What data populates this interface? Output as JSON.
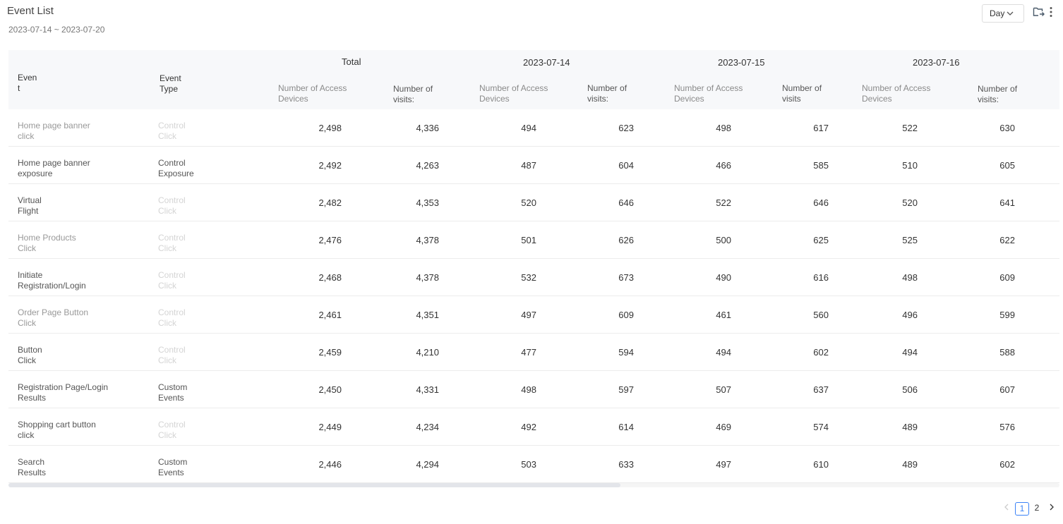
{
  "header": {
    "title": "Event List",
    "date_range": "2023-07-14 ~ 2023-07-20",
    "granularity": "Day"
  },
  "table": {
    "col_event": "Even\nt",
    "col_type": "Event\nType",
    "groups": [
      "Total",
      "2023-07-14",
      "2023-07-15",
      "2023-07-16"
    ],
    "sub_headers": [
      "Number of Access\nDevices",
      "Number of\nvisits:",
      "Number of Access\nDevices",
      "Number of\nvisits:",
      "Number of Access\nDevices",
      "Number of\nvisits",
      "Number of Access\nDevices",
      "Number of\nvisits:"
    ],
    "rows": [
      {
        "event": "Home page banner\nclick",
        "type": "Control\nClick",
        "values": [
          "2,498",
          "4,336",
          "494",
          "623",
          "498",
          "617",
          "522",
          "630"
        ]
      },
      {
        "event": "Home page banner\nexposure",
        "type": "Control\nExposure",
        "values": [
          "2,492",
          "4,263",
          "487",
          "604",
          "466",
          "585",
          "510",
          "605"
        ]
      },
      {
        "event": "Virtual\nFlight",
        "type": "Control\nClick",
        "values": [
          "2,482",
          "4,353",
          "520",
          "646",
          "522",
          "646",
          "520",
          "641"
        ]
      },
      {
        "event": "Home Products\nClick",
        "type": "Control\nClick",
        "values": [
          "2,476",
          "4,378",
          "501",
          "626",
          "500",
          "625",
          "525",
          "622"
        ]
      },
      {
        "event": "Initiate\nRegistration/Login",
        "type": "Control\nClick",
        "values": [
          "2,468",
          "4,378",
          "532",
          "673",
          "490",
          "616",
          "498",
          "609"
        ]
      },
      {
        "event": "Order Page Button\nClick",
        "type": "Control\nClick",
        "values": [
          "2,461",
          "4,351",
          "497",
          "609",
          "461",
          "560",
          "496",
          "599"
        ]
      },
      {
        "event": "Button\nClick",
        "type": "Control\nClick",
        "values": [
          "2,459",
          "4,210",
          "477",
          "594",
          "494",
          "602",
          "494",
          "588"
        ]
      },
      {
        "event": "Registration Page/Login\nResults",
        "type": "Custom\nEvents",
        "values": [
          "2,450",
          "4,331",
          "498",
          "597",
          "507",
          "637",
          "506",
          "607"
        ]
      },
      {
        "event": "Shopping cart button\nclick",
        "type": "Control\nClick",
        "values": [
          "2,449",
          "4,234",
          "492",
          "614",
          "469",
          "574",
          "489",
          "576"
        ]
      },
      {
        "event": "Search\nResults",
        "type": "Custom\nEvents",
        "values": [
          "2,446",
          "4,294",
          "503",
          "633",
          "497",
          "610",
          "489",
          "602"
        ]
      }
    ]
  },
  "pagination": {
    "pages": [
      "1",
      "2"
    ],
    "current": "1"
  },
  "icons": {
    "dropdown": "chevron-down-icon",
    "export": "folder-export-icon",
    "more": "more-vertical-icon",
    "prev": "chevron-left-icon",
    "next": "chevron-right-icon"
  },
  "colors": {
    "accent": "#3b82f6",
    "header_bg": "#f7f8fa"
  }
}
